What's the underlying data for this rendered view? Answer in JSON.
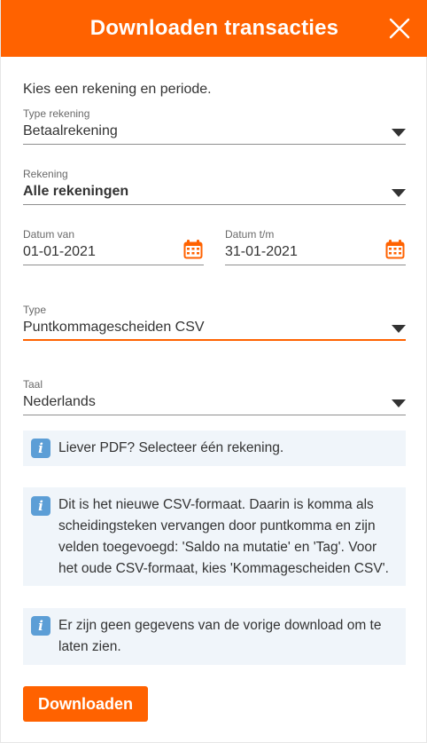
{
  "header": {
    "title": "Downloaden transacties",
    "close_icon": "close-icon"
  },
  "intro": "Kies een rekening en periode.",
  "form": {
    "type_rekening": {
      "label": "Type rekening",
      "value": "Betaalrekening"
    },
    "rekening": {
      "label": "Rekening",
      "value": "Alle rekeningen"
    },
    "datum_van": {
      "label": "Datum van",
      "value": "01-01-2021",
      "icon": "calendar-icon"
    },
    "datum_tm": {
      "label": "Datum t/m",
      "value": "31-01-2021",
      "icon": "calendar-icon"
    },
    "type": {
      "label": "Type",
      "value": "Puntkommagescheiden CSV"
    },
    "taal": {
      "label": "Taal",
      "value": "Nederlands"
    }
  },
  "infos": [
    {
      "icon": "info-icon",
      "text": "Liever PDF? Selecteer één rekening."
    },
    {
      "icon": "info-icon",
      "text": "Dit is het nieuwe CSV-formaat. Daarin is komma als scheidingsteken vervangen door puntkomma en zijn velden toegevoegd: 'Saldo na mutatie' en 'Tag'. Voor het oude CSV-formaat, kies 'Kommagescheiden CSV'."
    },
    {
      "icon": "info-icon",
      "text": "Er zijn geen gegevens van de vorige download om te laten zien."
    }
  ],
  "download_button": "Downloaden",
  "colors": {
    "brand": "#ff6200",
    "info_bg": "#f0f5fa",
    "info_icon": "#5c9ed6"
  }
}
